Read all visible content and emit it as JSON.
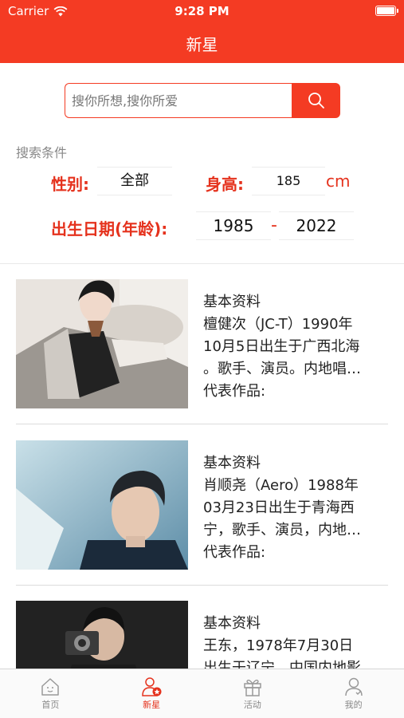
{
  "status_bar": {
    "carrier": "Carrier",
    "time": "9:28 PM"
  },
  "nav": {
    "title": "新星"
  },
  "search": {
    "placeholder": "搜你所想,搜你所爱"
  },
  "filter": {
    "title": "搜索条件",
    "gender_label": "性别:",
    "gender_value": "全部",
    "height_label": "身高:",
    "height_value": "185",
    "height_unit": "cm",
    "birth_label": "出生日期(年龄):",
    "birth_from": "1985",
    "birth_sep": "-",
    "birth_to": "2022"
  },
  "cards": [
    {
      "l1": "基本资料",
      "l2": "檀健次（JC-T）1990年",
      "l3": "10月5日出生于广西北海",
      "l4": "。歌手、演员。内地唱…",
      "l5": "代表作品:"
    },
    {
      "l1": "基本资料",
      "l2": "肖顺尧（Aero）1988年",
      "l3": "03月23日出生于青海西",
      "l4": "宁，歌手、演员，内地…",
      "l5": "代表作品:"
    },
    {
      "l1": "基本资料",
      "l2": "王东，1978年7月30日",
      "l3": "出生于辽宁，中国内地影",
      "l4": "",
      "l5": ""
    }
  ],
  "tabbar": [
    {
      "label": "首页"
    },
    {
      "label": "新星"
    },
    {
      "label": "活动"
    },
    {
      "label": "我的"
    }
  ],
  "colors": {
    "accent": "#f43b23",
    "label_red": "#e5321d"
  }
}
